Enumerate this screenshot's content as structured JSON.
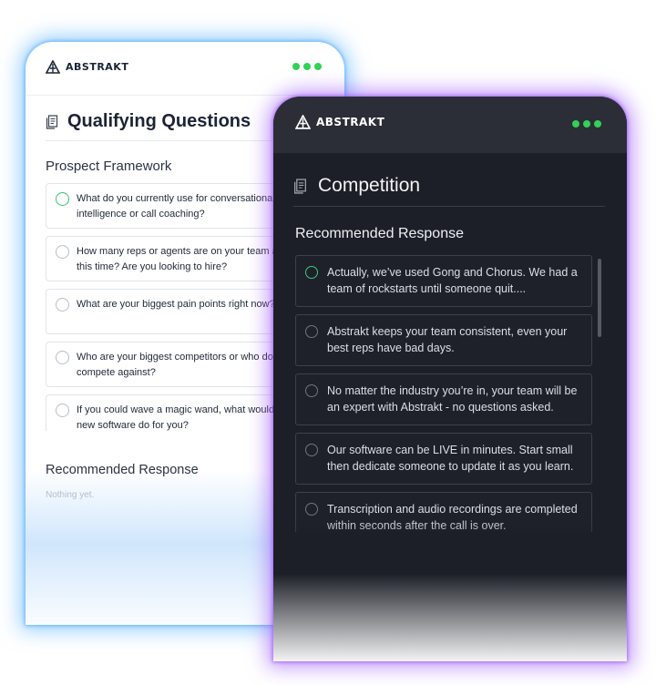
{
  "brand": {
    "name": "ABSTRAKT",
    "accent": "#34d058"
  },
  "light_card": {
    "title": "Qualifying Questions",
    "section": "Prospect Framework",
    "questions": [
      {
        "line1": "What do you currently use for conversational",
        "line2": "intelligence or call coaching?"
      },
      {
        "line1": "How many reps or agents are on your team at",
        "line2": "this time? Are you looking to hire?"
      },
      {
        "line1": "What are your biggest pain points right now?",
        "line2": ""
      },
      {
        "line1": "Who are your biggest competitors or who do",
        "line2": "compete against?"
      },
      {
        "line1": "If you could wave a magic wand, what would",
        "line2": "new software do for you?"
      }
    ],
    "recommended_label": "Recommended Response",
    "empty_text": "Nothing yet."
  },
  "dark_card": {
    "title": "Competition",
    "section": "Recommended Response",
    "responses": [
      "Actually, we’ve used Gong and Chorus. We had a team of rockstarts until someone quit....",
      "Abstrakt keeps your team consistent, even your best reps have bad days.",
      "No matter the industry you’re in, your team will be an expert with Abstrakt - no questions asked.",
      "Our software can be LIVE in minutes. Start small then dedicate someone to update it as you learn.",
      "Transcription and audio recordings are completed within seconds after the call is over."
    ]
  },
  "icons": [
    "abstrakt-logo-icon",
    "window-dots-icon",
    "document-icon",
    "radio-circle-icon"
  ]
}
